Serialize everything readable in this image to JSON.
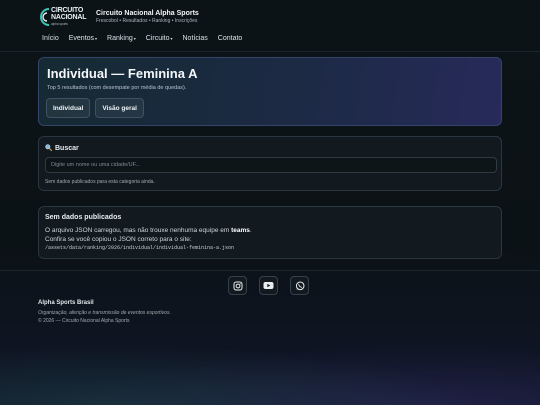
{
  "header": {
    "logo_line1": "CIRCUITO",
    "logo_line2": "NACIONAL",
    "logo_line3": "alpha sports",
    "title": "Circuito Nacional Alpha Sports",
    "subtitle": "Frescobol • Resultados • Ranking • Inscrições"
  },
  "nav": {
    "items": [
      {
        "label": "Início"
      },
      {
        "label": "Eventos",
        "caret": "▾"
      },
      {
        "label": "Ranking",
        "caret": "▾"
      },
      {
        "label": "Circuito",
        "caret": "▾"
      },
      {
        "label": "Notícias"
      },
      {
        "label": "Contato"
      }
    ]
  },
  "hero": {
    "title": "Individual — Feminina A",
    "subtitle": "Top 5 resultados (com desempate por média de quedas).",
    "buttons": [
      "Individual",
      "Visão geral"
    ]
  },
  "search": {
    "title": "Buscar",
    "icon": "magnifier-icon",
    "placeholder": "Digite um nome ou uma cidade/UF...",
    "note": "Sem dados publicados para esta categoria ainda."
  },
  "info": {
    "title": "Sem dados publicados",
    "body_prefix": "O arquivo JSON carregou, mas não trouxe nenhuma equipe em ",
    "body_bold": "teams",
    "body_suffix": ".",
    "body_line2": "Confira se você copiou o JSON correto para o site:",
    "path": "/assets/data/ranking/2026/individual/individual-feminina-a.json"
  },
  "footer": {
    "socials": [
      "instagram-icon",
      "youtube-icon",
      "whatsapp-icon"
    ],
    "brand": "Alpha Sports Brasil",
    "description": "Organização, aferição e transmissão de eventos esportivos.",
    "copyright": "© 2026 — Circuito Nacional Alpha Sports"
  },
  "colors": {
    "background": "#0b1216",
    "hero_gradient_start": "#152a33",
    "hero_gradient_end": "#272a5a",
    "accent_teal": "#39c6b3"
  }
}
